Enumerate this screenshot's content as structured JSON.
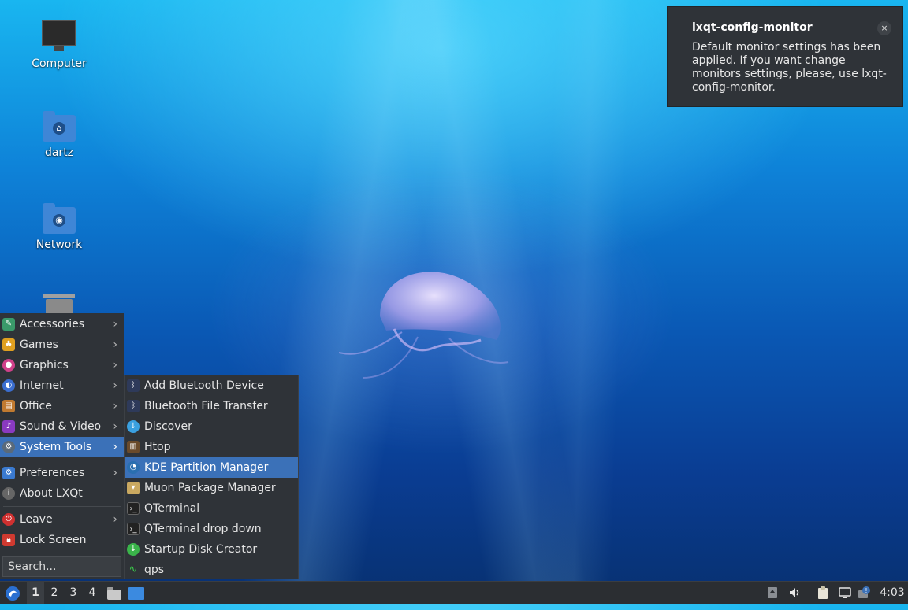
{
  "desktop": {
    "icons": [
      {
        "label": "Computer",
        "icon": "computer-icon"
      },
      {
        "label": "dartz",
        "icon": "home-folder-icon"
      },
      {
        "label": "Network",
        "icon": "network-folder-icon"
      },
      {
        "label": "",
        "icon": "trash-icon"
      }
    ]
  },
  "notification": {
    "title": "lxqt-config-monitor",
    "body": "Default monitor settings has been applied. If you want change monitors settings, please, use lxqt-config-monitor.",
    "close": "×"
  },
  "menu": {
    "items": [
      {
        "label": "Accessories",
        "icon": "accessories-icon",
        "color": "#3a9a6a"
      },
      {
        "label": "Games",
        "icon": "games-icon",
        "color": "#e0a020"
      },
      {
        "label": "Graphics",
        "icon": "graphics-icon",
        "color": "#d0408a"
      },
      {
        "label": "Internet",
        "icon": "internet-icon",
        "color": "#3b6ed0"
      },
      {
        "label": "Office",
        "icon": "office-icon",
        "color": "#c07a30"
      },
      {
        "label": "Sound & Video",
        "icon": "sound-video-icon",
        "color": "#8a3ac0"
      },
      {
        "label": "System Tools",
        "icon": "system-tools-icon",
        "color": "#5a6a7a"
      },
      {
        "label": "Preferences",
        "icon": "preferences-icon",
        "color": "#3a7ad0"
      },
      {
        "label": "About LXQt",
        "icon": "about-icon",
        "color": "#666666"
      },
      {
        "label": "Leave",
        "icon": "leave-icon",
        "color": "#d03030"
      },
      {
        "label": "Lock Screen",
        "icon": "lock-icon",
        "color": "#d03a30"
      }
    ],
    "arrow": "›",
    "search_placeholder": "Search..."
  },
  "submenu": {
    "items": [
      {
        "label": "Add Bluetooth Device",
        "icon": "bluetooth-icon"
      },
      {
        "label": "Bluetooth File Transfer",
        "icon": "bluetooth-icon"
      },
      {
        "label": "Discover",
        "icon": "discover-icon"
      },
      {
        "label": "Htop",
        "icon": "htop-icon"
      },
      {
        "label": "KDE Partition Manager",
        "icon": "partition-manager-icon"
      },
      {
        "label": "Muon Package Manager",
        "icon": "muon-icon"
      },
      {
        "label": "QTerminal",
        "icon": "terminal-icon"
      },
      {
        "label": "QTerminal drop down",
        "icon": "terminal-icon"
      },
      {
        "label": "Startup Disk Creator",
        "icon": "startup-disk-icon"
      },
      {
        "label": "qps",
        "icon": "qps-icon"
      }
    ]
  },
  "taskbar": {
    "desktops": [
      "1",
      "2",
      "3",
      "4"
    ],
    "active_desktop": "1",
    "clock": "4:03"
  },
  "colors": {
    "accent": "#3b71b8",
    "panel": "#2f3338"
  }
}
